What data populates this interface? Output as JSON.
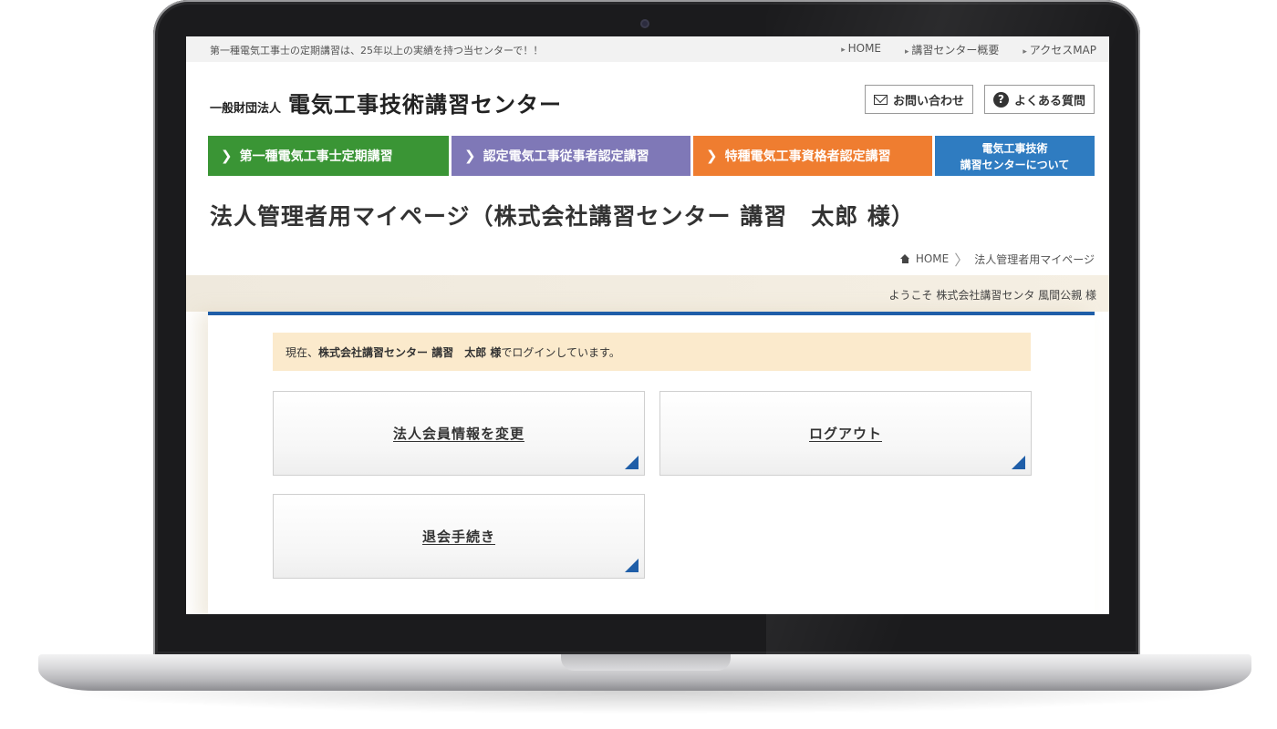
{
  "topbar": {
    "tagline": "第一種電気工事士の定期講習は、25年以上の実績を持つ当センターで！！",
    "links": [
      "HOME",
      "講習センター概要",
      "アクセスMAP"
    ]
  },
  "header": {
    "org_type": "一般財団法人",
    "org_name": "電気工事技術講習センター",
    "contact_label": "お問い合わせ",
    "faq_label": "よくある質問",
    "faq_icon_glyph": "?"
  },
  "nav": {
    "items": [
      {
        "label": "第一種電気工事士定期講習",
        "color": "#3a9535"
      },
      {
        "label": "認定電気工事従事者認定講習",
        "color": "#7f78b7"
      },
      {
        "label": "特種電気工事資格者認定講習",
        "color": "#ef7d30"
      }
    ],
    "about": {
      "line1": "電気工事技術",
      "line2": "講習センターについて",
      "color": "#2f7cc1"
    },
    "chevron": "❯"
  },
  "page": {
    "title": "法人管理者用マイページ（株式会社講習センター 講習　太郎 様）"
  },
  "breadcrumb": {
    "home": "HOME",
    "current": "法人管理者用マイページ",
    "separator": "〉"
  },
  "welcome": {
    "text": "ようこそ 株式会社講習センタ 風間公親 様"
  },
  "login_notice": {
    "prefix": "現在、",
    "name": "株式会社講習センター 講習　太郎 様",
    "suffix": " でログインしています。"
  },
  "tiles": {
    "change_info": "法人会員情報を変更",
    "logout": "ログアウト",
    "withdraw": "退会手続き"
  },
  "colors": {
    "accent_blue": "#1f5ea8",
    "notice_bg": "#fbeacc"
  }
}
